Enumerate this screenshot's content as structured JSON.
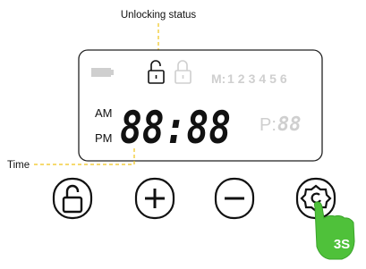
{
  "annotations": {
    "unlocking_status": "Unlocking status",
    "time": "Time"
  },
  "display": {
    "am": "AM",
    "pm": "PM",
    "time_digits": "88:88",
    "memory_label": "M:",
    "memory_slots": "123456",
    "program_label": "P:",
    "program_digits": "88"
  },
  "buttons": {
    "hold_label": "3S"
  },
  "colors": {
    "accent_green": "#4fc13a",
    "lcd_dark": "#1a1a1a",
    "lcd_dim": "#cfcfcf",
    "frame": "#222222"
  },
  "icons": {
    "unlock": "unlocked-padlock-icon",
    "lock": "locked-padlock-icon",
    "battery": "battery-icon",
    "plus": "plus-icon",
    "minus": "minus-icon",
    "settings": "gear-icon",
    "hand": "pointing-hand-icon"
  }
}
